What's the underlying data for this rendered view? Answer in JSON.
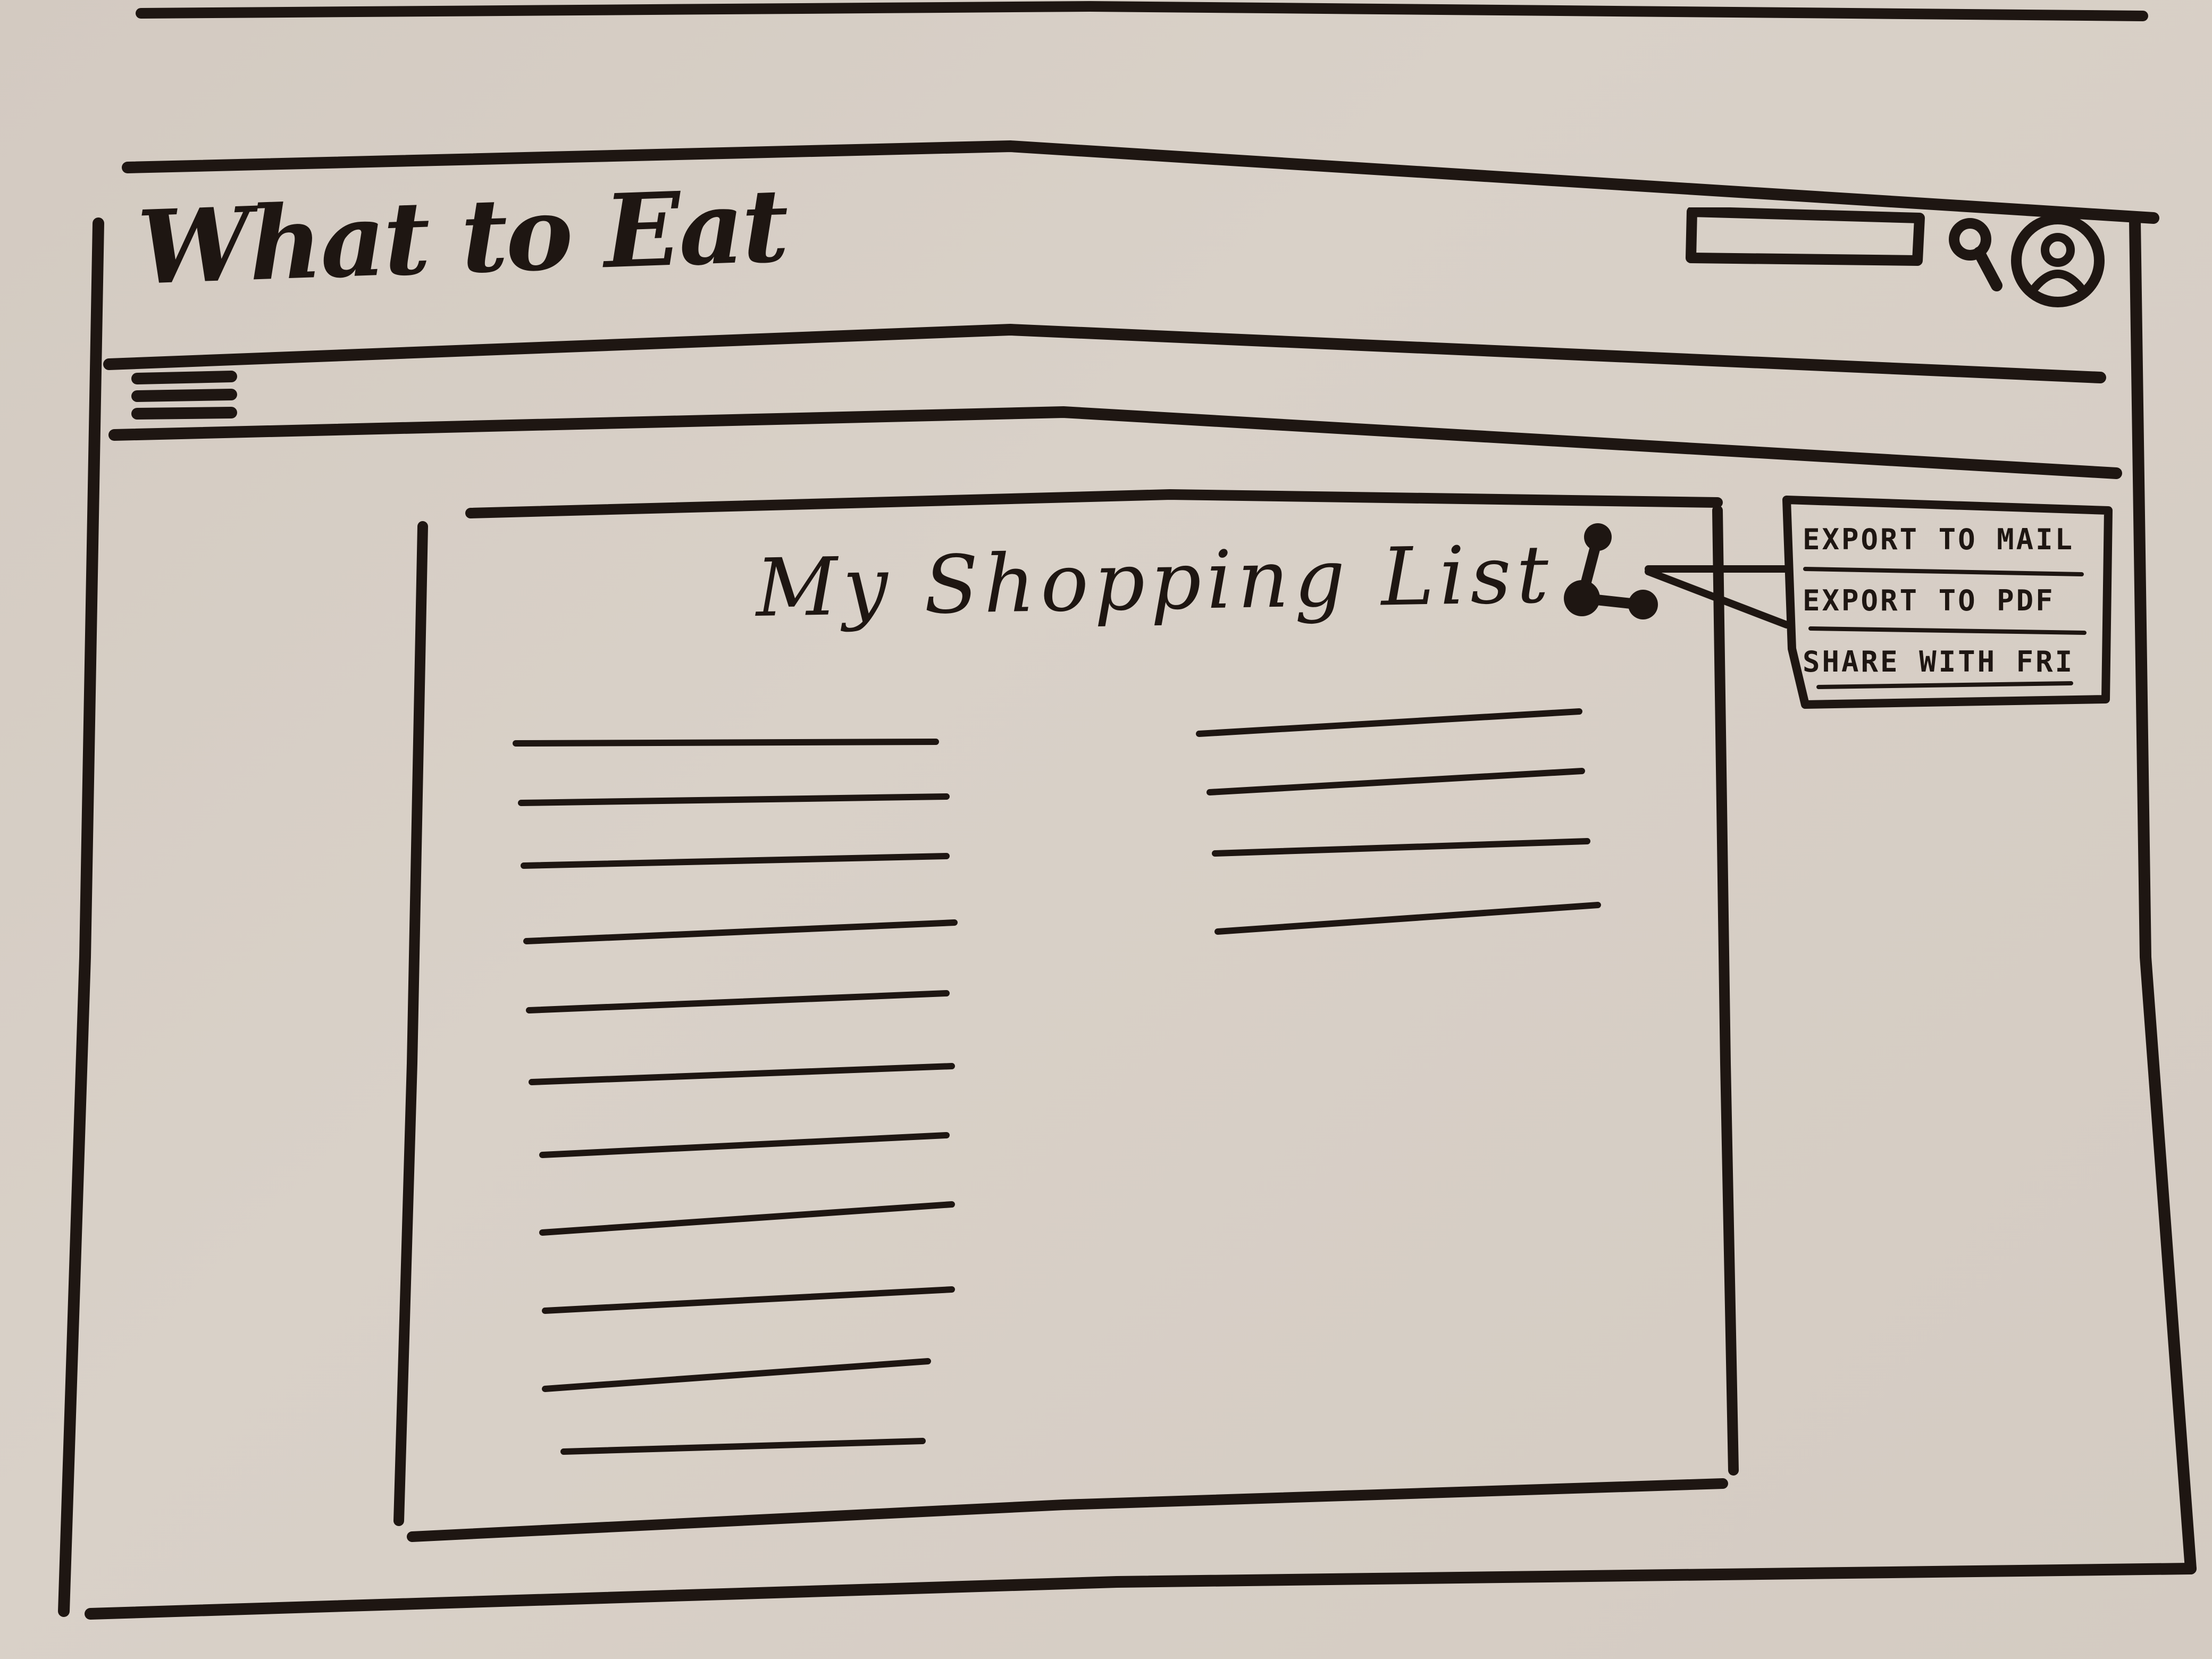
{
  "header": {
    "app_title": "What to Eat"
  },
  "main": {
    "page_title": "My Shopping List"
  },
  "share_menu": {
    "items": [
      {
        "label": "EXPORT TO MAIL"
      },
      {
        "label": "EXPORT TO PDF"
      },
      {
        "label": "SHARE WITH FRI"
      }
    ]
  },
  "icons": {
    "search": "search-icon",
    "account": "account-icon",
    "menu": "hamburger-menu-icon",
    "share": "share-icon"
  }
}
